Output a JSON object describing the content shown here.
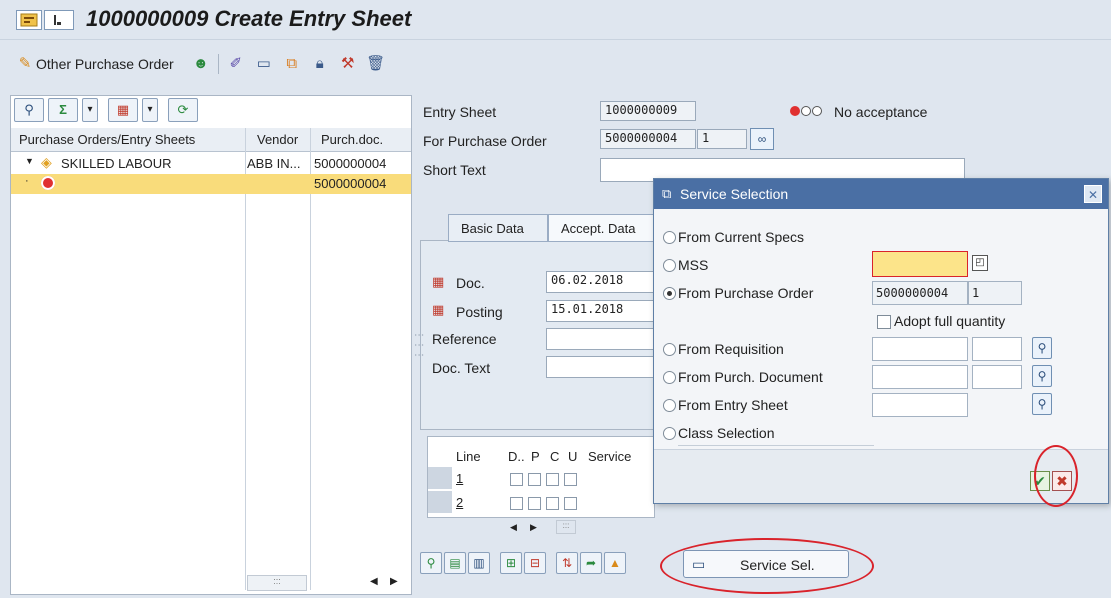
{
  "window": {
    "title": "1000000009 Create Entry Sheet"
  },
  "toolbar": {
    "other_po_label": "Other Purchase Order",
    "icons": [
      "other-po-icon",
      "people-icon",
      "edit-glasses-icon",
      "new-doc-icon",
      "copy-icon",
      "lock-icon",
      "tools-icon",
      "delete-icon"
    ]
  },
  "left": {
    "col_headers": [
      "Purchase Orders/Entry Sheets",
      "Vendor",
      "Purch.doc."
    ],
    "rows": [
      {
        "name": "SKILLED LABOUR",
        "vendor": "ABB IN...",
        "doc": "5000000004"
      },
      {
        "name": "",
        "vendor": "",
        "doc": "5000000004"
      }
    ],
    "scroll_text": ":::"
  },
  "header": {
    "entry_sheet_label": "Entry Sheet",
    "entry_sheet_value": "1000000009",
    "status_text": "No acceptance",
    "for_po_label": "For Purchase Order",
    "for_po_value": "5000000004",
    "for_po_item": "1",
    "short_text_label": "Short Text",
    "short_text_value": ""
  },
  "tabs": [
    {
      "label": "Basic Data"
    },
    {
      "label": "Accept. Data"
    }
  ],
  "basic": {
    "doc_label": "Doc.",
    "doc_value": "06.02.2018",
    "posting_label": "Posting",
    "posting_value": "15.01.2018",
    "reference_label": "Reference",
    "doc_text_label": "Doc. Text"
  },
  "lines": {
    "headers": [
      "Line",
      "D..",
      "P",
      "C",
      "U",
      "Service"
    ],
    "rows": [
      {
        "line": "1"
      },
      {
        "line": "2"
      }
    ]
  },
  "dialog": {
    "title": "Service Selection",
    "options": [
      {
        "label": "From Current Specs",
        "selected": false
      },
      {
        "label": "MSS",
        "selected": false
      },
      {
        "label": "From Purchase Order",
        "selected": true
      },
      {
        "label": "From Requisition",
        "selected": false
      },
      {
        "label": "From Purch. Document",
        "selected": false
      },
      {
        "label": "From Entry Sheet",
        "selected": false
      },
      {
        "label": "Class Selection",
        "selected": false
      }
    ],
    "po_value": "5000000004",
    "po_item": "1",
    "adopt_label": "Adopt full quantity",
    "adopt_checked": false
  },
  "bottom": {
    "service_sel_label": "Service Sel."
  },
  "colors": {
    "dialog_title_bg": "#4a6fa4",
    "highlight_yellow": "#f9dc7b",
    "annotation_red": "#d9232b"
  }
}
